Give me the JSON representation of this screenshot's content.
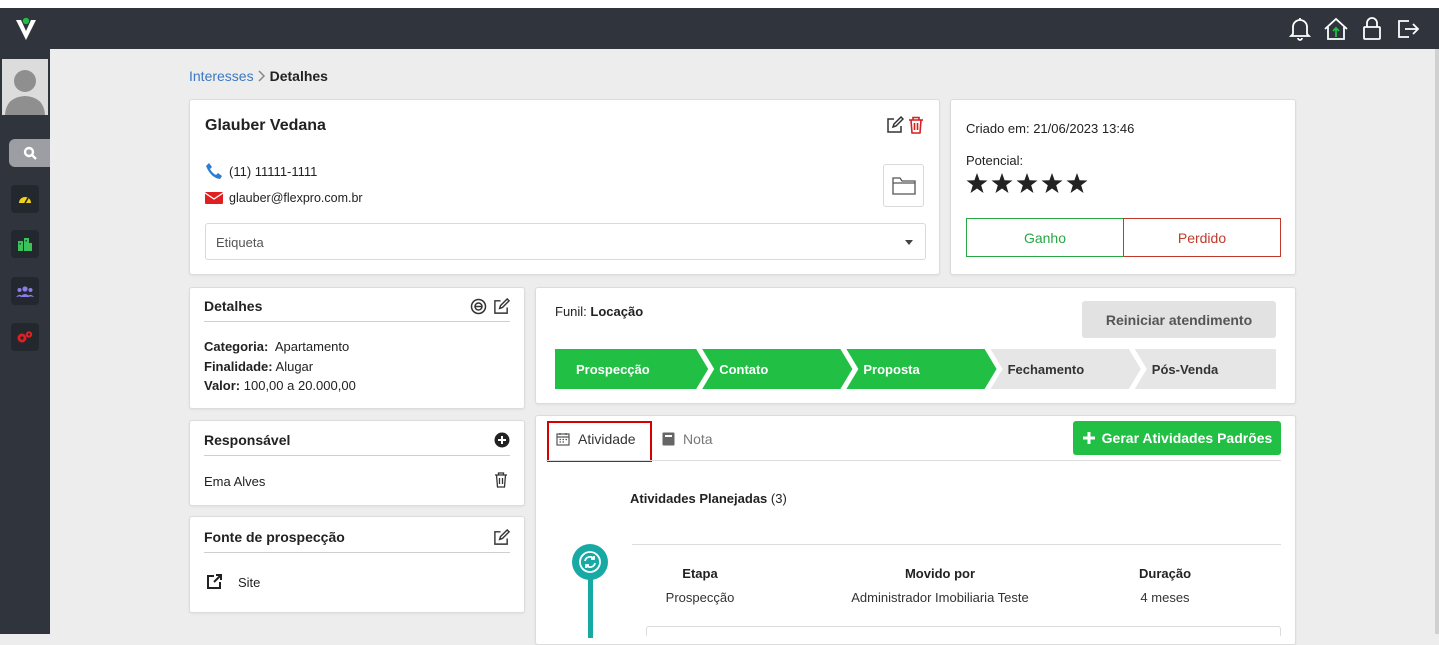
{
  "breadcrumb": {
    "parent": "Interesses",
    "current": "Detalhes"
  },
  "lead": {
    "name": "Glauber Vedana",
    "phone": "(11) 11111-1111",
    "email": "glauber@flexpro.com.br",
    "tag_placeholder": "Etiqueta"
  },
  "status_card": {
    "created": "Criado em: 21/06/2023 13:46",
    "potential_label": "Potencial:",
    "stars": 5,
    "won_label": "Ganho",
    "lost_label": "Perdido"
  },
  "details": {
    "title": "Detalhes",
    "category_label": "Categoria:",
    "category_value": "Apartamento",
    "purpose_label": "Finalidade:",
    "purpose_value": "Alugar",
    "value_label": "Valor:",
    "value_value": "100,00 a 20.000,00"
  },
  "responsible": {
    "title": "Responsável",
    "name": "Ema Alves"
  },
  "source": {
    "title": "Fonte de prospecção",
    "value": "Site"
  },
  "funnel": {
    "label": "Funil:",
    "name": "Locação",
    "restart_label": "Reiniciar atendimento",
    "stages": [
      {
        "label": "Prospecção",
        "done": true
      },
      {
        "label": "Contato",
        "done": true
      },
      {
        "label": "Proposta",
        "done": true
      },
      {
        "label": "Fechamento",
        "done": false
      },
      {
        "label": "Pós-Venda",
        "done": false
      }
    ]
  },
  "activity": {
    "tab_activity": "Atividade",
    "tab_note": "Nota",
    "generate_label": "Gerar Atividades Padrões",
    "planned_title": "Atividades Planejadas",
    "planned_count": "(3)",
    "columns": {
      "stage": "Etapa",
      "moved_by": "Movido por",
      "duration": "Duração"
    },
    "row": {
      "stage": "Prospecção",
      "moved_by": "Administrador Imobiliaria Teste",
      "duration": "4 meses"
    }
  },
  "colors": {
    "accent_green": "#22bf45",
    "teal": "#17a9a4",
    "sidebar": "#2f343d",
    "highlight_red": "#d60000"
  }
}
